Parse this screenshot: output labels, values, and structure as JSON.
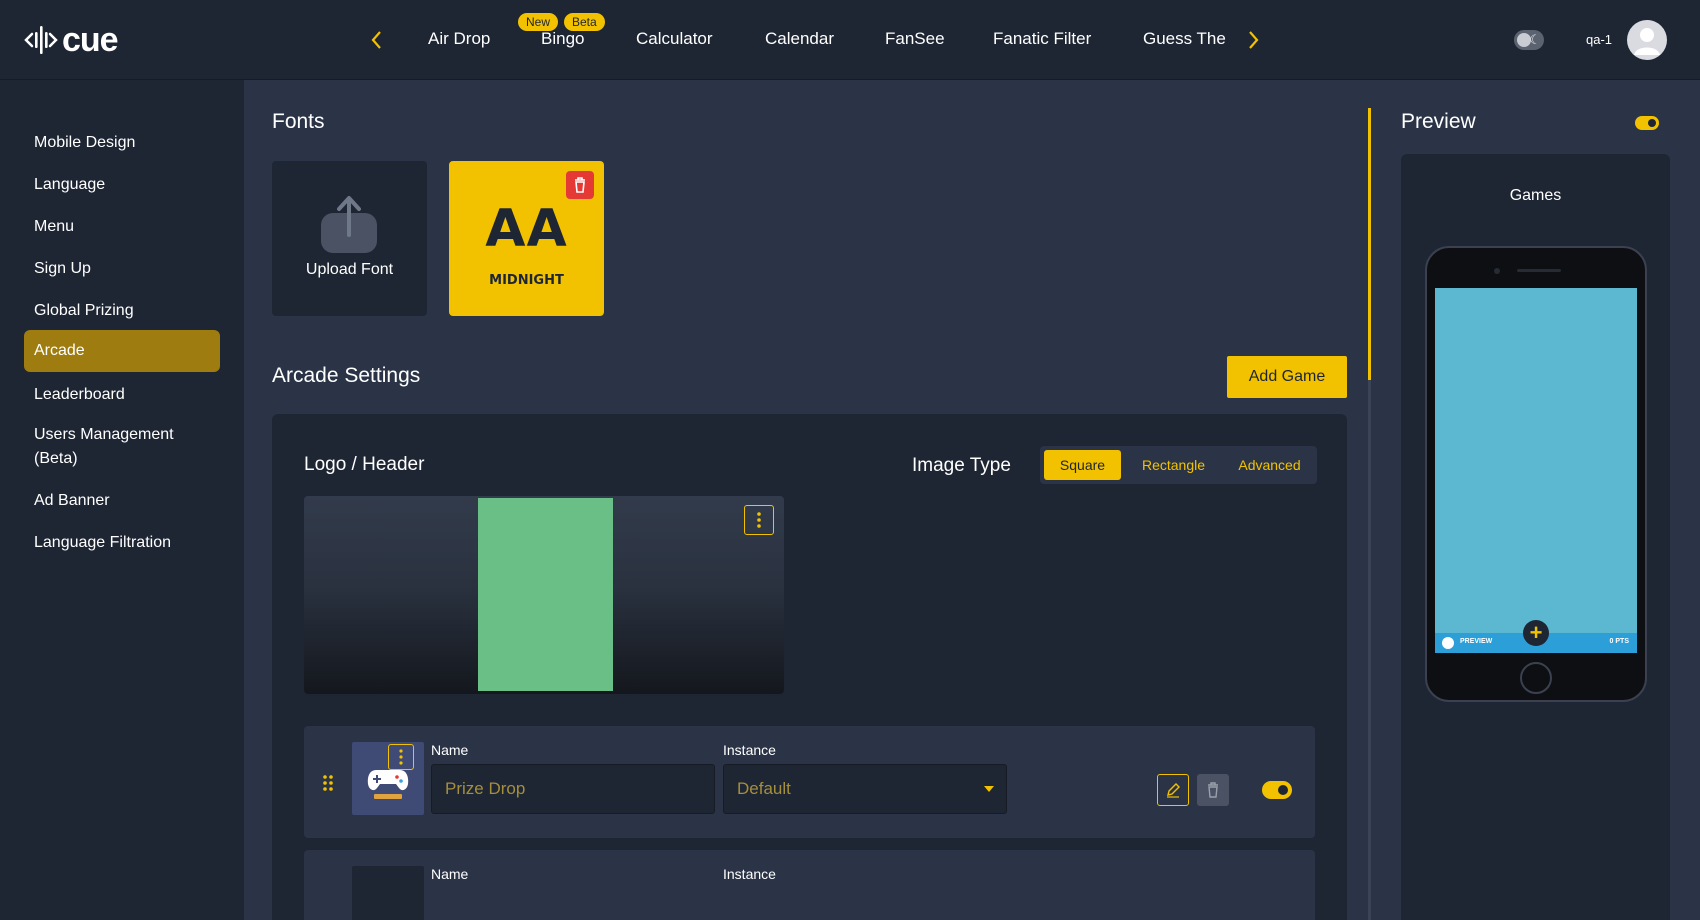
{
  "app": {
    "brand": "cue"
  },
  "nav": {
    "tabs": [
      {
        "label": "Air Drop"
      },
      {
        "label": "Bingo",
        "badges": [
          "New",
          "Beta"
        ]
      },
      {
        "label": "Calculator"
      },
      {
        "label": "Calendar"
      },
      {
        "label": "FanSee"
      },
      {
        "label": "Fanatic Filter"
      },
      {
        "label": "Guess The"
      }
    ]
  },
  "user": {
    "name": "qa-1"
  },
  "sidebar": {
    "items": [
      {
        "label": "Mobile Design"
      },
      {
        "label": "Language"
      },
      {
        "label": "Menu"
      },
      {
        "label": "Sign Up"
      },
      {
        "label": "Global Prizing"
      },
      {
        "label": "Arcade",
        "active": true
      },
      {
        "label": "Leaderboard"
      },
      {
        "label": "Users Management (Beta)"
      },
      {
        "label": "Ad Banner"
      },
      {
        "label": "Language Filtration"
      }
    ]
  },
  "fonts": {
    "title": "Fonts",
    "upload_label": "Upload Font",
    "font_card": {
      "sample": "AA",
      "name": "MIDNIGHT"
    }
  },
  "arcade": {
    "title": "Arcade Settings",
    "add_game_label": "Add Game",
    "logo_header_label": "Logo / Header",
    "image_type": {
      "label": "Image Type",
      "options": [
        "Square",
        "Rectangle",
        "Advanced"
      ],
      "selected": "Square"
    },
    "games": [
      {
        "name_label": "Name",
        "name_value": "Prize Drop",
        "instance_label": "Instance",
        "instance_value": "Default",
        "enabled": true
      },
      {
        "name_label": "Name",
        "instance_label": "Instance"
      }
    ]
  },
  "preview": {
    "title": "Preview",
    "screen_title": "Games",
    "bar_left": "PREVIEW",
    "bar_right": "0 PTS",
    "enabled": true
  },
  "colors": {
    "accent": "#f2c200",
    "background": "#2b3447",
    "panel": "#1e2533",
    "active_sidebar": "#9e7c10",
    "delete_red": "#e53935",
    "logo_image_green": "#69bf85",
    "phone_screen": "#5cb8d1"
  },
  "icons": [
    "cue-logo-icon",
    "chevron-left-icon",
    "chevron-right-icon",
    "theme-toggle-icon",
    "avatar-icon",
    "upload-icon",
    "trash-icon",
    "kebab-menu-icon",
    "drag-handle-icon",
    "pencil-icon",
    "caret-down-icon",
    "plus-icon"
  ]
}
